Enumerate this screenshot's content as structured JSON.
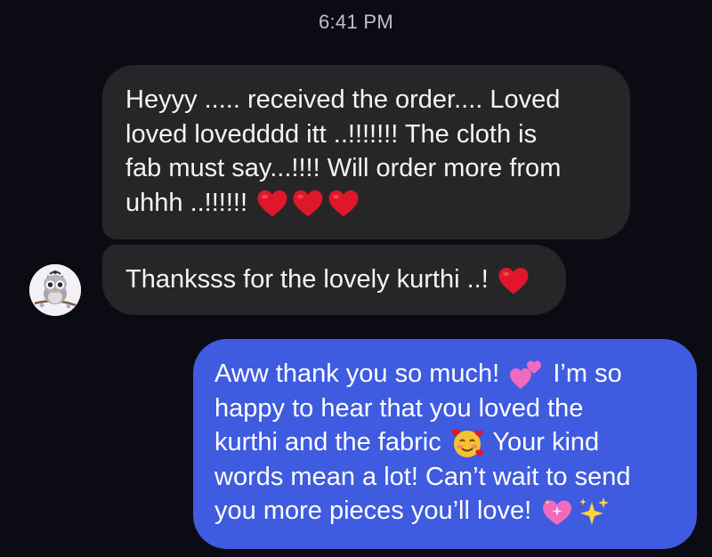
{
  "status": {
    "time": "6:41 PM"
  },
  "thread": {
    "incoming": [
      {
        "lines": [
          "Heyyy ..... received the order.... Loved",
          "loved lovedddd itt ..!!!!!!! The cloth is",
          "fab must say...!!!! Will order more from",
          "uhhh ..!!!!!!"
        ],
        "emojis": [
          "red-heart",
          "red-heart",
          "red-heart"
        ]
      },
      {
        "lines": [
          "Thanksss for the lovely kurthi ..!"
        ],
        "emojis": [
          "red-heart"
        ]
      }
    ],
    "outgoing": {
      "segments": [
        "Aww thank you so much!",
        "I’m so",
        "happy to hear that you loved the",
        "kurthi and the fabric",
        "Your kind",
        "words mean a lot! Can’t wait to send",
        "you more pieces you’ll love!"
      ],
      "emojis": [
        "two-hearts",
        "smiling-face-with-hearts",
        "sparkling-heart",
        "sparkles"
      ]
    }
  },
  "colors": {
    "background": "#0b0b14",
    "incoming_bubble": "#262629",
    "outgoing_bubble": "#3f5bdf",
    "heart": "#e0162b",
    "text": "#f4f4f6",
    "timestamp": "#bfc1c9"
  }
}
